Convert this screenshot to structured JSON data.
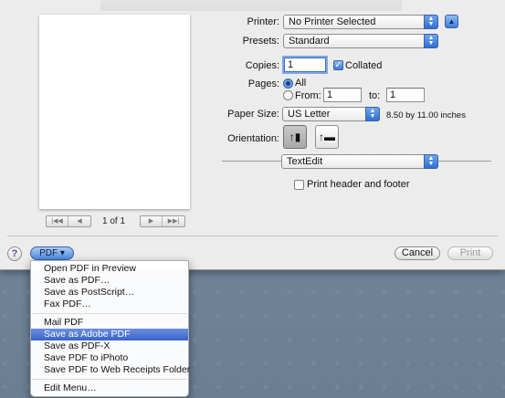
{
  "preview": {
    "page_indicator": "1 of 1",
    "nav_first": "|◀◀",
    "nav_prev": "◀",
    "nav_next": "▶",
    "nav_last": "▶▶|"
  },
  "form": {
    "printer_label": "Printer:",
    "printer_value": "No Printer Selected",
    "presets_label": "Presets:",
    "presets_value": "Standard",
    "copies_label": "Copies:",
    "copies_value": "1",
    "collated_label": "Collated",
    "collated_checked": true,
    "pages_label": "Pages:",
    "pages_all_label": "All",
    "pages_from_label": "From:",
    "pages_from_value": "1",
    "pages_to_label": "to:",
    "pages_to_value": "1",
    "paper_size_label": "Paper Size:",
    "paper_size_value": "US Letter",
    "paper_dimensions": "8.50 by 11.00 inches",
    "orientation_label": "Orientation:",
    "section_value": "TextEdit",
    "header_footer_label": "Print header and footer"
  },
  "bottom_bar": {
    "help_label": "?",
    "pdf_label": "PDF ▾",
    "cancel_label": "Cancel",
    "print_label": "Print"
  },
  "pdf_menu": {
    "items": [
      "Open PDF in Preview",
      "Save as PDF…",
      "Save as PostScript…",
      "Fax PDF…",
      "Mail PDF",
      "Save as Adobe PDF",
      "Save as PDF-X",
      "Save PDF to iPhoto",
      "Save PDF to Web Receipts Folder",
      "Edit Menu…"
    ],
    "highlighted": "Save as Adobe PDF"
  },
  "colors": {
    "accent": "#3a63c8",
    "desktop": "#6e8196",
    "sheet": "#ececec"
  }
}
